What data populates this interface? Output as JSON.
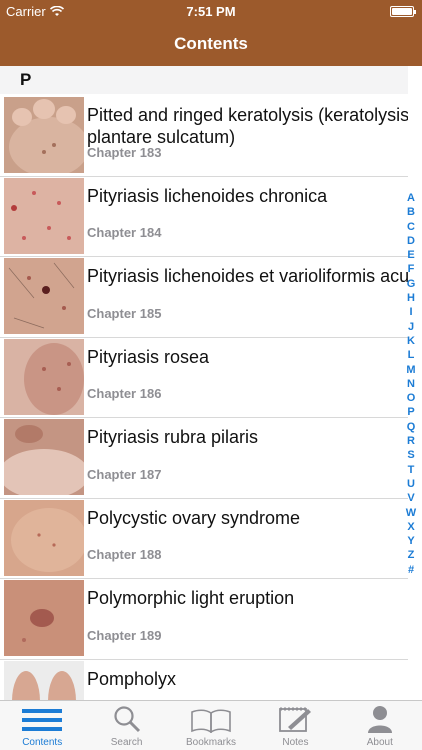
{
  "status": {
    "carrier": "Carrier",
    "time": "7:51 PM"
  },
  "nav": {
    "title": "Contents"
  },
  "section": {
    "letter": "P"
  },
  "items": [
    {
      "title": "Pitted and ringed keratolysis (keratolysis plantare sulcatum)",
      "chapter": "Chapter 183"
    },
    {
      "title": "Pityriasis lichenoides chronica",
      "chapter": "Chapter 184"
    },
    {
      "title": "Pityriasis lichenoides et varioliformis acuta",
      "chapter": "Chapter 185"
    },
    {
      "title": "Pityriasis rosea",
      "chapter": "Chapter 186"
    },
    {
      "title": "Pityriasis rubra pilaris",
      "chapter": "Chapter 187"
    },
    {
      "title": "Polycystic ovary syndrome",
      "chapter": "Chapter 188"
    },
    {
      "title": "Polymorphic light eruption",
      "chapter": "Chapter 189"
    },
    {
      "title": "Pompholyx",
      "chapter": ""
    }
  ],
  "index": [
    "A",
    "B",
    "C",
    "D",
    "E",
    "F",
    "G",
    "H",
    "I",
    "J",
    "K",
    "L",
    "M",
    "N",
    "O",
    "P",
    "Q",
    "R",
    "S",
    "T",
    "U",
    "V",
    "W",
    "X",
    "Y",
    "Z",
    "#"
  ],
  "tabs": {
    "contents": "Contents",
    "search": "Search",
    "bookmarks": "Bookmarks",
    "notes": "Notes",
    "about": "About"
  },
  "colors": {
    "header": "#9c5a2c",
    "accent": "#1c7cd5"
  }
}
